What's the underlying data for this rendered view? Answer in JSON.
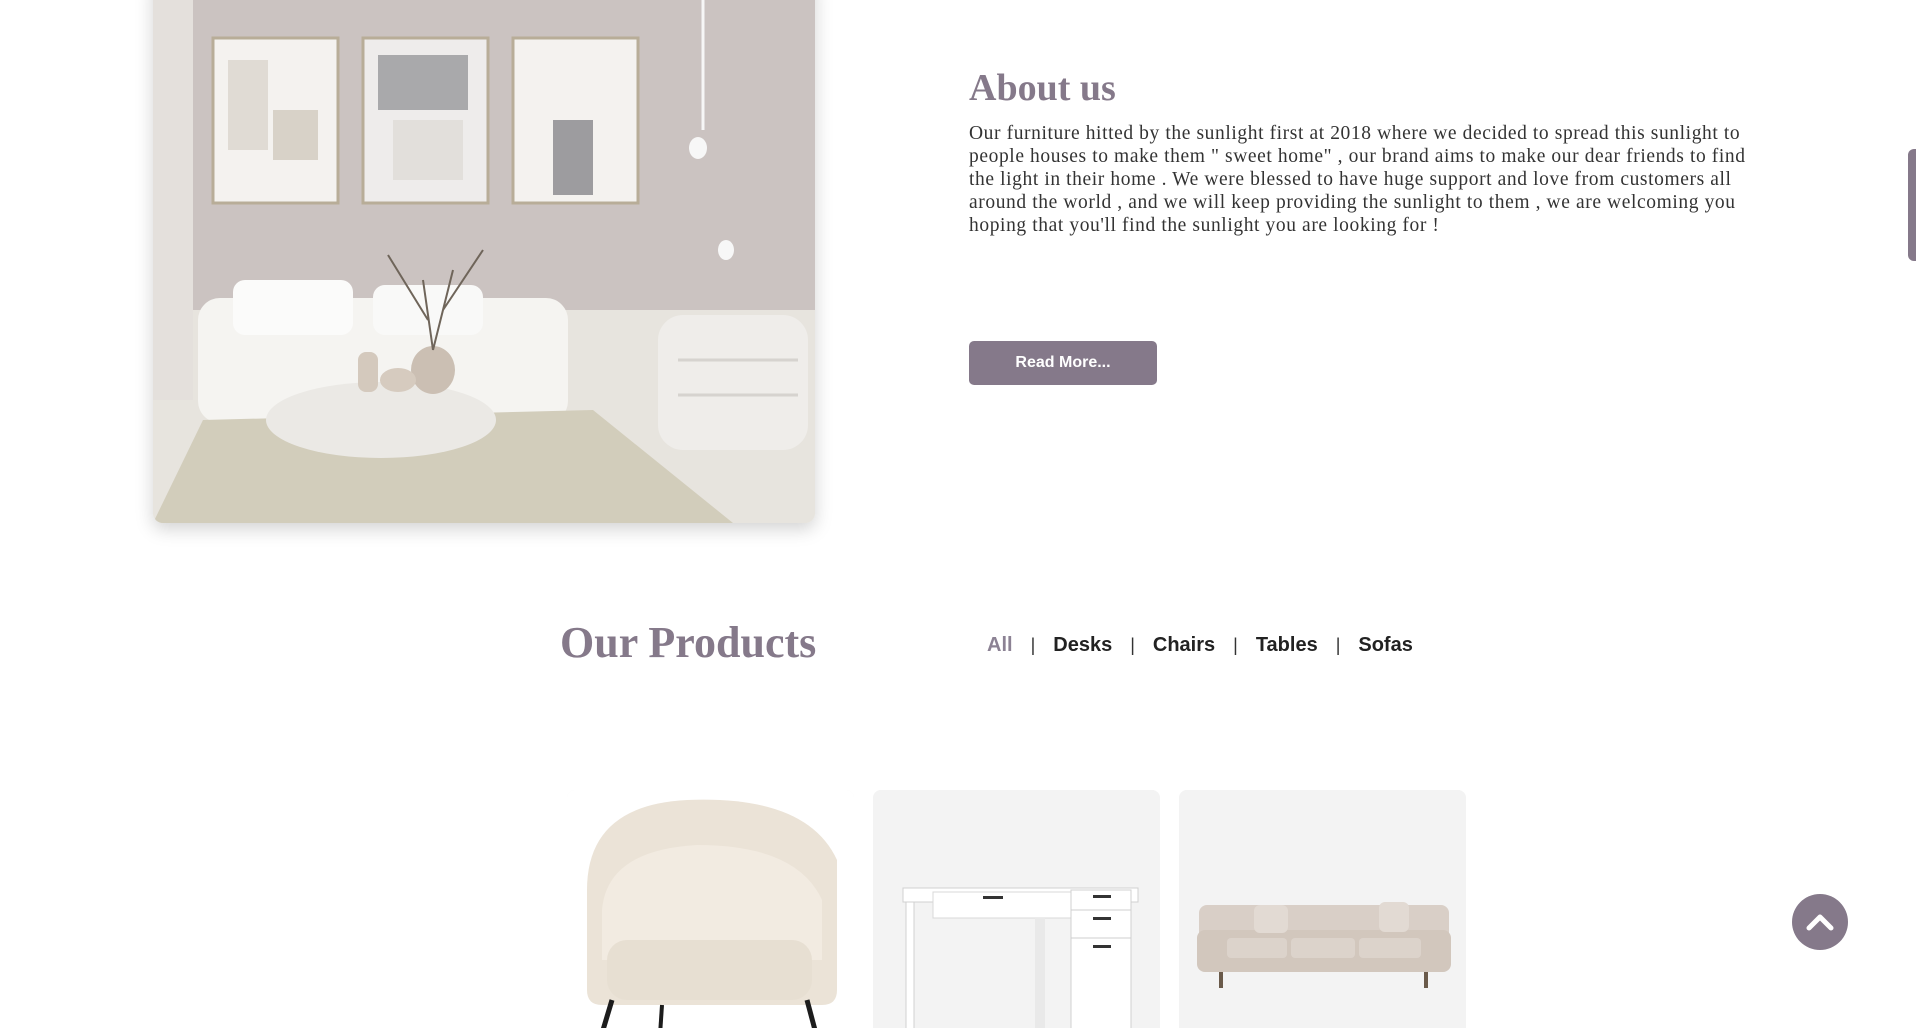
{
  "about": {
    "title": "About us",
    "text": "Our furniture hitted by the sunlight first at 2018 where we decided to spread this sunlight to people houses to make them \" sweet home\" , our brand aims to make our dear friends to find the light in their home . We were blessed to have huge support and love from customers all around the world , and we will keep providing the sunlight to them , we are welcoming you hoping that you'll find the sunlight you are looking for !",
    "read_more_label": "Read More..."
  },
  "products": {
    "title": "Our Products",
    "filters": [
      {
        "label": "All",
        "active": true
      },
      {
        "label": "Desks",
        "active": false
      },
      {
        "label": "Chairs",
        "active": false
      },
      {
        "label": "Tables",
        "active": false
      },
      {
        "label": "Sofas",
        "active": false
      }
    ],
    "items": [
      {
        "icon": "armchair-image"
      },
      {
        "icon": "desk-image"
      },
      {
        "icon": "sofa-image"
      }
    ]
  },
  "scroll_top": {
    "icon": "chevron-up-icon"
  },
  "colors": {
    "accent": "#85798a",
    "text": "#333333",
    "card_bg": "#f3f3f3"
  }
}
